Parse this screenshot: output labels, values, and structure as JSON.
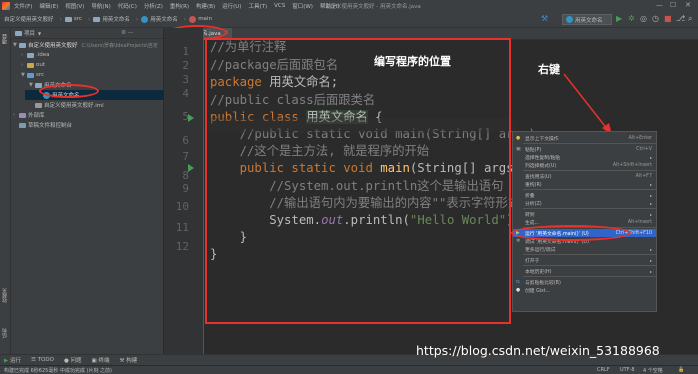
{
  "menubar": {
    "items": [
      "文件(F)",
      "编辑(E)",
      "视图(V)",
      "导航(N)",
      "代码(C)",
      "分析(Z)",
      "重构(R)",
      "构建(B)",
      "运行(U)",
      "工具(T)",
      "VCS",
      "窗口(W)",
      "帮助(H)"
    ],
    "title": "自定义使用英文般好 - 用英文命名.java"
  },
  "navbar": {
    "breadcrumbs": [
      "自定义使用英文般好",
      "src",
      "用英文命名",
      "用英文命名",
      "main"
    ],
    "run_config": "用英文命名"
  },
  "project": {
    "header": "项目",
    "root_label": "自定义使用英文般好",
    "root_path": "C:\\Users\\罗森\\IdeaProjects\\自定",
    "items": [
      ".idea",
      "out",
      "src",
      "用英文命名",
      "用英文命名",
      "自定义使用英文般好.iml",
      "外部库",
      "草稿文件和控制台"
    ]
  },
  "left_tabs": [
    "项目",
    "结构",
    "收藏夹"
  ],
  "editor": {
    "tab": "用英文命名.java",
    "line_numbers": [
      "1",
      "2",
      "3",
      "4",
      "5",
      "6",
      "7",
      "8",
      "9",
      "10",
      "11",
      "12"
    ],
    "lines": {
      "l1": "//为单行注释",
      "l2": "//package后面跟包名",
      "l3_kw": "package",
      "l3_rest": " 用英文命名;",
      "l4": "//public class后面跟类名",
      "l5_kw": "public class",
      "l5_name": "用英文命名",
      "l5_brace": " {",
      "l6": "    //public static void main(String[] args)",
      "l7": "    //这个是主方法, 就是程序的开始",
      "l8_kw": "    public static void",
      "l8_fn": " main",
      "l8_rest": "(String[] args) {",
      "l9": "        //System.out.println这个是输出语句",
      "l10": "        //输出语句内为要输出的内容\"\"表示字符形式",
      "l11_a": "        System.",
      "l11_out": "out",
      "l11_b": ".println(",
      "l11_str": "\"Hello World\"",
      "l11_c": ");",
      "l12": "    }",
      "l13": "}"
    }
  },
  "annotations": {
    "code_area": "编写程序的位置",
    "right_click": "右键"
  },
  "context_menu": {
    "items": [
      {
        "label": "显示上下文操作",
        "key": "Alt+Enter"
      },
      {
        "label": "粘贴(P)",
        "key": "Ctrl+V"
      },
      {
        "label": "选择性复制/粘贴",
        "key": ""
      },
      {
        "label": "列选择模式(U)",
        "key": "Alt+Shift+Insert"
      },
      {
        "label": "查找用法(U)",
        "key": "Alt+F7"
      },
      {
        "label": "重构(R)",
        "key": ""
      },
      {
        "label": "折叠",
        "key": ""
      },
      {
        "label": "分析(Z)",
        "key": ""
      },
      {
        "label": "转到",
        "key": ""
      },
      {
        "label": "生成...",
        "key": "Alt+Insert"
      },
      {
        "label": "运行 '用英文命名.main()' (U)",
        "key": "Ctrl+Shift+F10"
      },
      {
        "label": "调试 '用英文命名.main()' (D)",
        "key": ""
      },
      {
        "label": "更多运行/调试",
        "key": ""
      },
      {
        "label": "打开于",
        "key": ""
      },
      {
        "label": "本地历史(H)",
        "key": ""
      },
      {
        "label": "与剪贴板比较(B)",
        "key": ""
      },
      {
        "label": "创建 Gist...",
        "key": ""
      }
    ]
  },
  "bottom_tabs": [
    "运行",
    "TODO",
    "问题",
    "终端",
    "构建"
  ],
  "status": {
    "left": "构建已完成 6秒625毫秒 中成功完成 (片刻 之前)",
    "right": [
      "CRLF",
      "UTF-8",
      "4 个空格"
    ]
  },
  "watermark": "https://blog.csdn.net/weixin_53188968",
  "colors": {
    "annotation_red": "#e8312d",
    "selection_blue": "#2f65ca",
    "run_green": "#499c54"
  }
}
